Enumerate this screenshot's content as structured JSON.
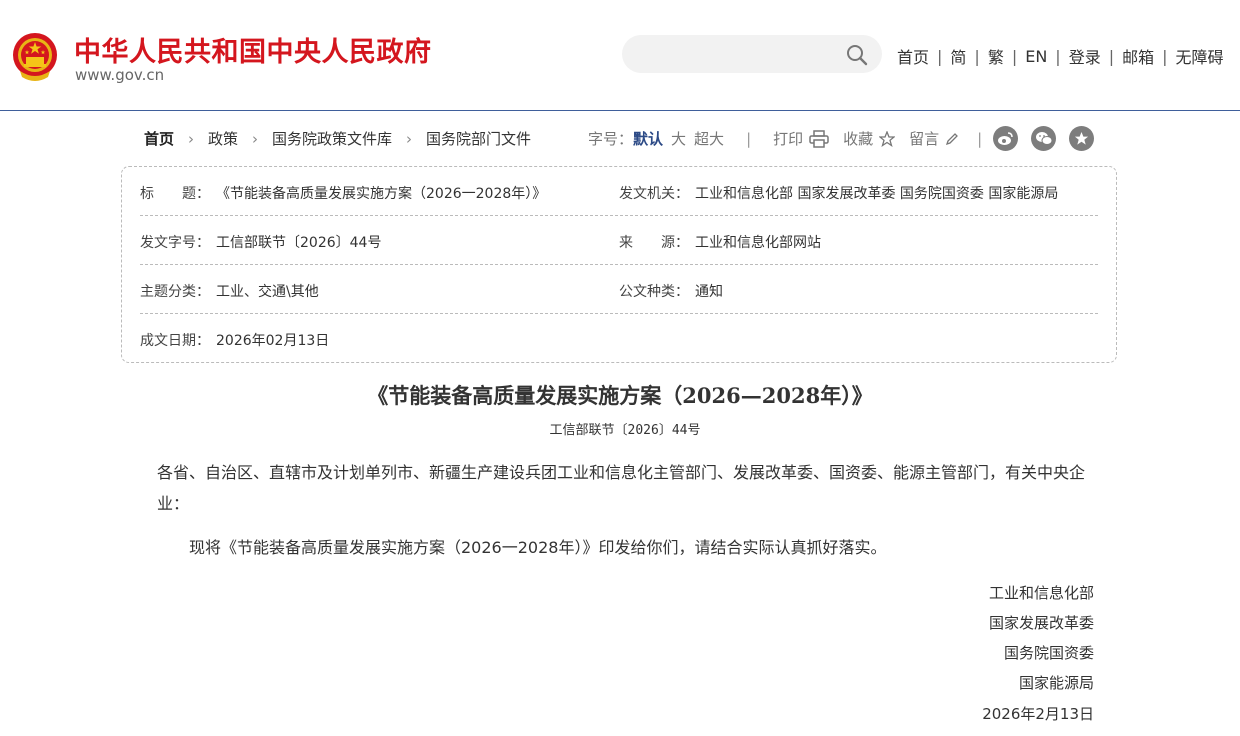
{
  "header": {
    "site_title": "中华人民共和国中央人民政府",
    "site_domain": "www.gov.cn",
    "search_placeholder": "",
    "nav": [
      "首页",
      "简",
      "繁",
      "EN",
      "登录",
      "邮箱",
      "无障碍"
    ],
    "nav_separator": "|"
  },
  "breadcrumb": [
    "首页",
    "政策",
    "国务院政策文件库",
    "国务院部门文件"
  ],
  "toolbar": {
    "font_size_label": "字号：",
    "font_sizes": [
      "默认",
      "大",
      "超大"
    ],
    "separator": "|",
    "print": "打印",
    "favorite": "收藏",
    "comment": "留言"
  },
  "share": [
    "weibo-icon",
    "wechat-icon",
    "star-icon"
  ],
  "meta": {
    "title_label": "标　　题：",
    "title_value": "《节能装备高质量发展实施方案（2026一2028年）》",
    "issuer_label": "发文机关：",
    "issuer_value": "工业和信息化部  国家发展改革委  国务院国资委  国家能源局",
    "doc_no_label": "发文字号：",
    "doc_no_value": "工信部联节〔2026〕44号",
    "source_label": "来　　源：",
    "source_value": "工业和信息化部网站",
    "category_label": "主题分类：",
    "category_value": "工业、交通\\其他",
    "type_label": "公文种类：",
    "type_value": "通知",
    "date_label": "成文日期：",
    "date_value": "2026年02月13日"
  },
  "article": {
    "title": "《节能装备高质量发展实施方案（2026—2028年）》",
    "doc_no": "工信部联节〔2026〕44号",
    "salutation": "各省、自治区、直辖市及计划单列市、新疆生产建设兵团工业和信息化主管部门、发展改革委、国资委、能源主管部门，有关中央企业：",
    "body": "现将《节能装备高质量发展实施方案（2026一2028年）》印发给你们，请结合实际认真抓好落实。",
    "signatories": [
      "工业和信息化部",
      "国家发展改革委",
      "国务院国资委",
      "国家能源局"
    ],
    "sign_date": "2026年2月13日"
  },
  "colors": {
    "brand_red": "#d4161e",
    "header_rule": "#3f5f9b",
    "active_font_size": "#2c4a86",
    "share_icon_bg": "#7d7d7d"
  }
}
